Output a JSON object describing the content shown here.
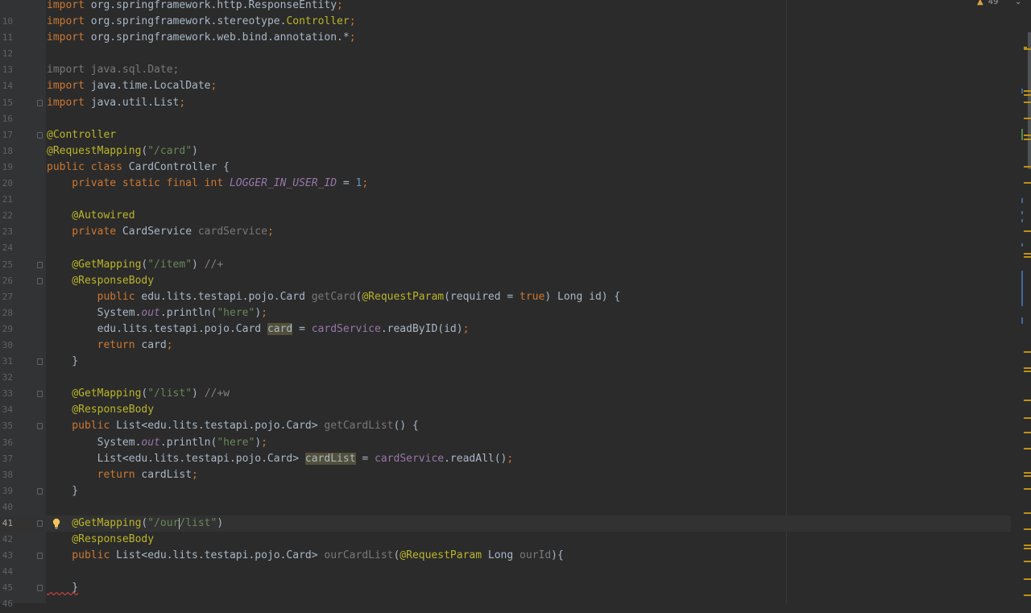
{
  "inspection": {
    "warning_count": "49"
  },
  "lines": [
    {
      "n": "",
      "tokens": [
        {
          "t": "import ",
          "c": "kw"
        },
        {
          "t": "org.springframework.http.ResponseEntity"
        },
        {
          "t": ";",
          "c": "kw"
        }
      ]
    },
    {
      "n": "10",
      "tokens": [
        {
          "t": "import ",
          "c": "kw"
        },
        {
          "t": "org.springframework.stereotype."
        },
        {
          "t": "Controller",
          "c": "ann"
        },
        {
          "t": ";",
          "c": "kw"
        }
      ]
    },
    {
      "n": "11",
      "tokens": [
        {
          "t": "import ",
          "c": "kw"
        },
        {
          "t": "org.springframework.web.bind.annotation.*"
        },
        {
          "t": ";",
          "c": "kw"
        }
      ]
    },
    {
      "n": "12",
      "tokens": []
    },
    {
      "n": "13",
      "tokens": [
        {
          "t": "import java.sql.Date;",
          "c": "gray"
        }
      ]
    },
    {
      "n": "14",
      "tokens": [
        {
          "t": "import ",
          "c": "kw"
        },
        {
          "t": "java.time.LocalDate"
        },
        {
          "t": ";",
          "c": "kw"
        }
      ]
    },
    {
      "n": "15",
      "fold": true,
      "tokens": [
        {
          "t": "import ",
          "c": "kw"
        },
        {
          "t": "java.util.List"
        },
        {
          "t": ";",
          "c": "kw"
        }
      ]
    },
    {
      "n": "16",
      "tokens": []
    },
    {
      "n": "17",
      "fold": true,
      "tokens": [
        {
          "t": "@Controller",
          "c": "ann"
        }
      ]
    },
    {
      "n": "18",
      "tokens": [
        {
          "t": "@RequestMapping",
          "c": "ann"
        },
        {
          "t": "("
        },
        {
          "t": "\"/card\"",
          "c": "str"
        },
        {
          "t": ")"
        }
      ]
    },
    {
      "n": "19",
      "tokens": [
        {
          "t": "public class ",
          "c": "kw"
        },
        {
          "t": "CardController {"
        }
      ]
    },
    {
      "n": "20",
      "tokens": [
        {
          "t": "    private static final int ",
          "c": "kw"
        },
        {
          "t": "LOGGER_IN_USER_ID",
          "c": "fldi"
        },
        {
          "t": " = "
        },
        {
          "t": "1",
          "c": "num"
        },
        {
          "t": ";",
          "c": "kw"
        }
      ]
    },
    {
      "n": "21",
      "tokens": []
    },
    {
      "n": "22",
      "tokens": [
        {
          "t": "    @Autowired",
          "c": "ann"
        }
      ]
    },
    {
      "n": "23",
      "tokens": [
        {
          "t": "    private ",
          "c": "kw"
        },
        {
          "t": "CardService "
        },
        {
          "t": "cardService",
          "c": "gray"
        },
        {
          "t": ";",
          "c": "kw"
        }
      ]
    },
    {
      "n": "24",
      "tokens": []
    },
    {
      "n": "25",
      "fold": true,
      "tokens": [
        {
          "t": "    @GetMapping",
          "c": "ann"
        },
        {
          "t": "("
        },
        {
          "t": "\"/item\"",
          "c": "str"
        },
        {
          "t": ") "
        },
        {
          "t": "//+",
          "c": "cm"
        }
      ]
    },
    {
      "n": "26",
      "fold": true,
      "tokens": [
        {
          "t": "    @ResponseBody",
          "c": "ann"
        }
      ]
    },
    {
      "n": "27",
      "tokens": [
        {
          "t": "        public ",
          "c": "kw"
        },
        {
          "t": "edu.lits.testapi.pojo.Card "
        },
        {
          "t": "getCard",
          "c": "gray"
        },
        {
          "t": "("
        },
        {
          "t": "@RequestParam",
          "c": "ann"
        },
        {
          "t": "(required = "
        },
        {
          "t": "true",
          "c": "kw"
        },
        {
          "t": ") Long id) {"
        }
      ]
    },
    {
      "n": "28",
      "tokens": [
        {
          "t": "        System."
        },
        {
          "t": "out",
          "c": "fldi"
        },
        {
          "t": ".println("
        },
        {
          "t": "\"here\"",
          "c": "str"
        },
        {
          "t": ")"
        },
        {
          "t": ";",
          "c": "kw"
        }
      ]
    },
    {
      "n": "29",
      "tokens": [
        {
          "t": "        edu.lits.testapi.pojo.Card "
        },
        {
          "t": "card",
          "c": "hl2"
        },
        {
          "t": " = "
        },
        {
          "t": "cardService",
          "c": "fld"
        },
        {
          "t": ".readByID(id)"
        },
        {
          "t": ";",
          "c": "kw"
        }
      ]
    },
    {
      "n": "30",
      "tokens": [
        {
          "t": "        return ",
          "c": "kw"
        },
        {
          "t": "card"
        },
        {
          "t": ";",
          "c": "kw"
        }
      ]
    },
    {
      "n": "31",
      "fold": true,
      "tokens": [
        {
          "t": "    }"
        }
      ]
    },
    {
      "n": "32",
      "tokens": []
    },
    {
      "n": "33",
      "fold": true,
      "tokens": [
        {
          "t": "    @GetMapping",
          "c": "ann"
        },
        {
          "t": "("
        },
        {
          "t": "\"/list\"",
          "c": "str"
        },
        {
          "t": ") "
        },
        {
          "t": "//+w",
          "c": "cm"
        }
      ]
    },
    {
      "n": "34",
      "tokens": [
        {
          "t": "    @ResponseBody",
          "c": "ann"
        }
      ]
    },
    {
      "n": "35",
      "fold": true,
      "tokens": [
        {
          "t": "    public ",
          "c": "kw"
        },
        {
          "t": "List<edu.lits.testapi.pojo.Card> "
        },
        {
          "t": "getCardList",
          "c": "gray"
        },
        {
          "t": "() {"
        }
      ]
    },
    {
      "n": "36",
      "tokens": [
        {
          "t": "        System."
        },
        {
          "t": "out",
          "c": "fldi"
        },
        {
          "t": ".println("
        },
        {
          "t": "\"here\"",
          "c": "str"
        },
        {
          "t": ")"
        },
        {
          "t": ";",
          "c": "kw"
        }
      ]
    },
    {
      "n": "37",
      "tokens": [
        {
          "t": "        List<edu.lits.testapi.pojo.Card> "
        },
        {
          "t": "cardList",
          "c": "hl2"
        },
        {
          "t": " = "
        },
        {
          "t": "cardService",
          "c": "fld"
        },
        {
          "t": ".readAll()"
        },
        {
          "t": ";",
          "c": "kw"
        }
      ]
    },
    {
      "n": "38",
      "tokens": [
        {
          "t": "        return ",
          "c": "kw"
        },
        {
          "t": "cardList"
        },
        {
          "t": ";",
          "c": "kw"
        }
      ]
    },
    {
      "n": "39",
      "fold": true,
      "tokens": [
        {
          "t": "    }"
        }
      ]
    },
    {
      "n": "40",
      "tokens": []
    },
    {
      "n": "41",
      "fold": true,
      "bulb": true,
      "current": true,
      "tokens": [
        {
          "t": "    @GetMapping",
          "c": "ann"
        },
        {
          "t": "("
        },
        {
          "t": "\"/our",
          "c": "str"
        },
        {
          "caret": true
        },
        {
          "t": "/list\"",
          "c": "str"
        },
        {
          "t": ")"
        }
      ]
    },
    {
      "n": "42",
      "tokens": [
        {
          "t": "    @ResponseBody",
          "c": "ann"
        }
      ]
    },
    {
      "n": "43",
      "fold": true,
      "tokens": [
        {
          "t": "    public ",
          "c": "kw"
        },
        {
          "t": "List<edu.lits.testapi.pojo.Card> "
        },
        {
          "t": "ourCardList",
          "c": "gray"
        },
        {
          "t": "("
        },
        {
          "t": "@RequestParam",
          "c": "ann"
        },
        {
          "t": " Long "
        },
        {
          "t": "ourId",
          "c": "gray"
        },
        {
          "t": "){"
        }
      ]
    },
    {
      "n": "44",
      "tokens": []
    },
    {
      "n": "45",
      "fold": true,
      "tokens": [
        {
          "t": "    }",
          "c": "squig"
        }
      ]
    },
    {
      "n": "46",
      "tokens": []
    }
  ]
}
